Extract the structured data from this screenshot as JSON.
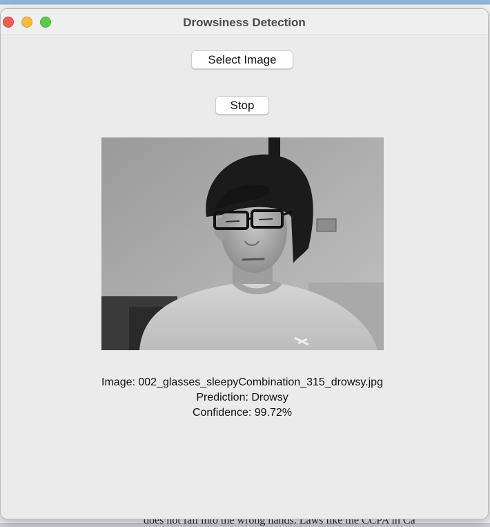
{
  "window": {
    "title": "Drowsiness Detection"
  },
  "controls": {
    "select_label": "Select Image",
    "stop_label": "Stop"
  },
  "result": {
    "image_line": "Image: 002_glasses_sleepyCombination_315_drowsy.jpg",
    "prediction_line": "Prediction: Drowsy",
    "confidence_line": "Confidence: 99.72%"
  },
  "background": {
    "partial_text": "does not fall into the wrong hands. Laws like the CCPA in Ca"
  },
  "colors": {
    "close": "#ee5f57",
    "minimize": "#f4bc3e",
    "maximize": "#5fc84b",
    "window_bg": "#ebebeb"
  }
}
